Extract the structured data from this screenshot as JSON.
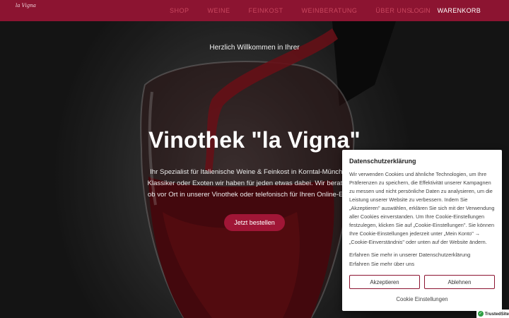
{
  "header": {
    "logo_text": "la Vigna",
    "nav": [
      "Shop",
      "Weine",
      "Feinkost",
      "Weinberatung",
      "Über uns"
    ],
    "login_label": "Login",
    "cart_label": "WARENKORB"
  },
  "hero": {
    "welcome": "Herzlich Willkommen in Ihrer",
    "title": "Vinothek \"la Vigna\"",
    "intro_lines": [
      "Ihr Spezialist für Italienische Weine & Feinkost in Korntal-Münchingen",
      "Klassiker oder Exoten wir haben für jeden etwas dabei. Wir beraten Sie",
      "ob vor Ort in unserer Vinothek oder telefonisch für Ihren Online-Einkauf"
    ],
    "cta_label": "Jetzt bestellen"
  },
  "cookie": {
    "title": "Datenschutzerklärung",
    "text": "Wir verwenden Cookies und ähnliche Technologien, um Ihre Präferenzen zu speichern, die Effektivität unserer Kampagnen zu messen und nicht persönliche Daten zu analysieren, um die Leistung unserer Website zu verbessern. Indem Sie „Akzeptieren\" auswählen, erklären Sie sich mit der Verwendung aller Cookies einverstanden. Um Ihre Cookie-Einstellungen festzulegen, klicken Sie auf „Cookie-Einstellungen\". Sie können Ihre Cookie-Einstellungen jederzeit unter „Mein Konto\" → „Cookie-Einverständnis\" oder unten auf der Website ändern.",
    "link_privacy": "Erfahren Sie mehr in unserer Datenschutzerklärung",
    "link_about": "Erfahren Sie mehr über uns",
    "accept_label": "Akzeptieren",
    "decline_label": "Ablehnen",
    "settings_label": "Cookie Einstellungen"
  },
  "badge": {
    "label": "TrustedSite",
    "icon": "check-icon"
  },
  "colors": {
    "brand": "#8c1431",
    "button": "#a01636"
  }
}
